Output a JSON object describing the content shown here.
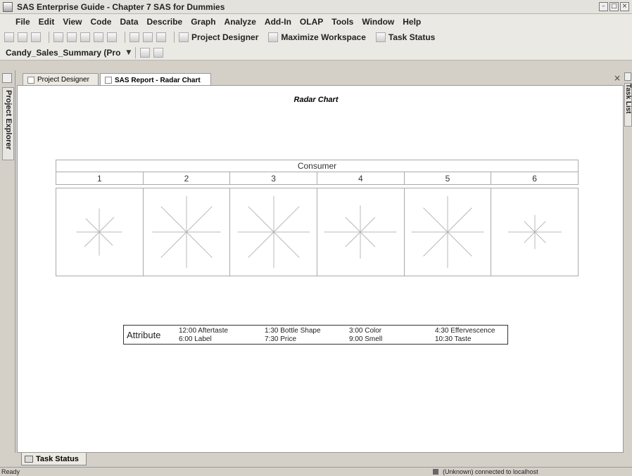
{
  "window": {
    "title": "SAS Enterprise Guide - Chapter 7 SAS for Dummies"
  },
  "menu": [
    "File",
    "Edit",
    "View",
    "Code",
    "Data",
    "Describe",
    "Graph",
    "Analyze",
    "Add-In",
    "OLAP",
    "Tools",
    "Window",
    "Help"
  ],
  "toolbar": {
    "project_designer": "Project Designer",
    "maximize_workspace": "Maximize Workspace",
    "task_status": "Task Status"
  },
  "toolbar2": {
    "dataset": "Candy_Sales_Summary (Pro"
  },
  "left_dock": {
    "project_explorer": "Project Explorer"
  },
  "right_dock": {
    "task_list": "Task List"
  },
  "tabs": [
    {
      "label": "Project Designer",
      "active": false
    },
    {
      "label": "SAS Report - Radar Chart",
      "active": true
    }
  ],
  "report": {
    "title": "Radar Chart",
    "group_header": "Consumer",
    "columns": [
      "1",
      "2",
      "3",
      "4",
      "5",
      "6"
    ],
    "legend": {
      "title": "Attribute",
      "items": [
        {
          "pos": "12:00",
          "name": "Aftertaste"
        },
        {
          "pos": "1:30",
          "name": "Bottle Shape"
        },
        {
          "pos": "3:00",
          "name": "Color"
        },
        {
          "pos": "4:30",
          "name": "Effervescence"
        },
        {
          "pos": "6:00",
          "name": "Label"
        },
        {
          "pos": "7:30",
          "name": "Price"
        },
        {
          "pos": "9:00",
          "name": "Smell"
        },
        {
          "pos": "10:30",
          "name": "Taste"
        }
      ],
      "item_labels": [
        "12:00 Aftertaste",
        "1:30 Bottle Shape",
        "3:00 Color",
        "4:30 Effervescence",
        "6:00 Label",
        "7:30 Price",
        "9:00 Smell",
        "10:30 Taste"
      ]
    },
    "axis_color": "#b8b8b8"
  },
  "bottom_tab": "Task Status",
  "status": {
    "left": "Ready",
    "right": "(Unknown) connected to localhost"
  }
}
